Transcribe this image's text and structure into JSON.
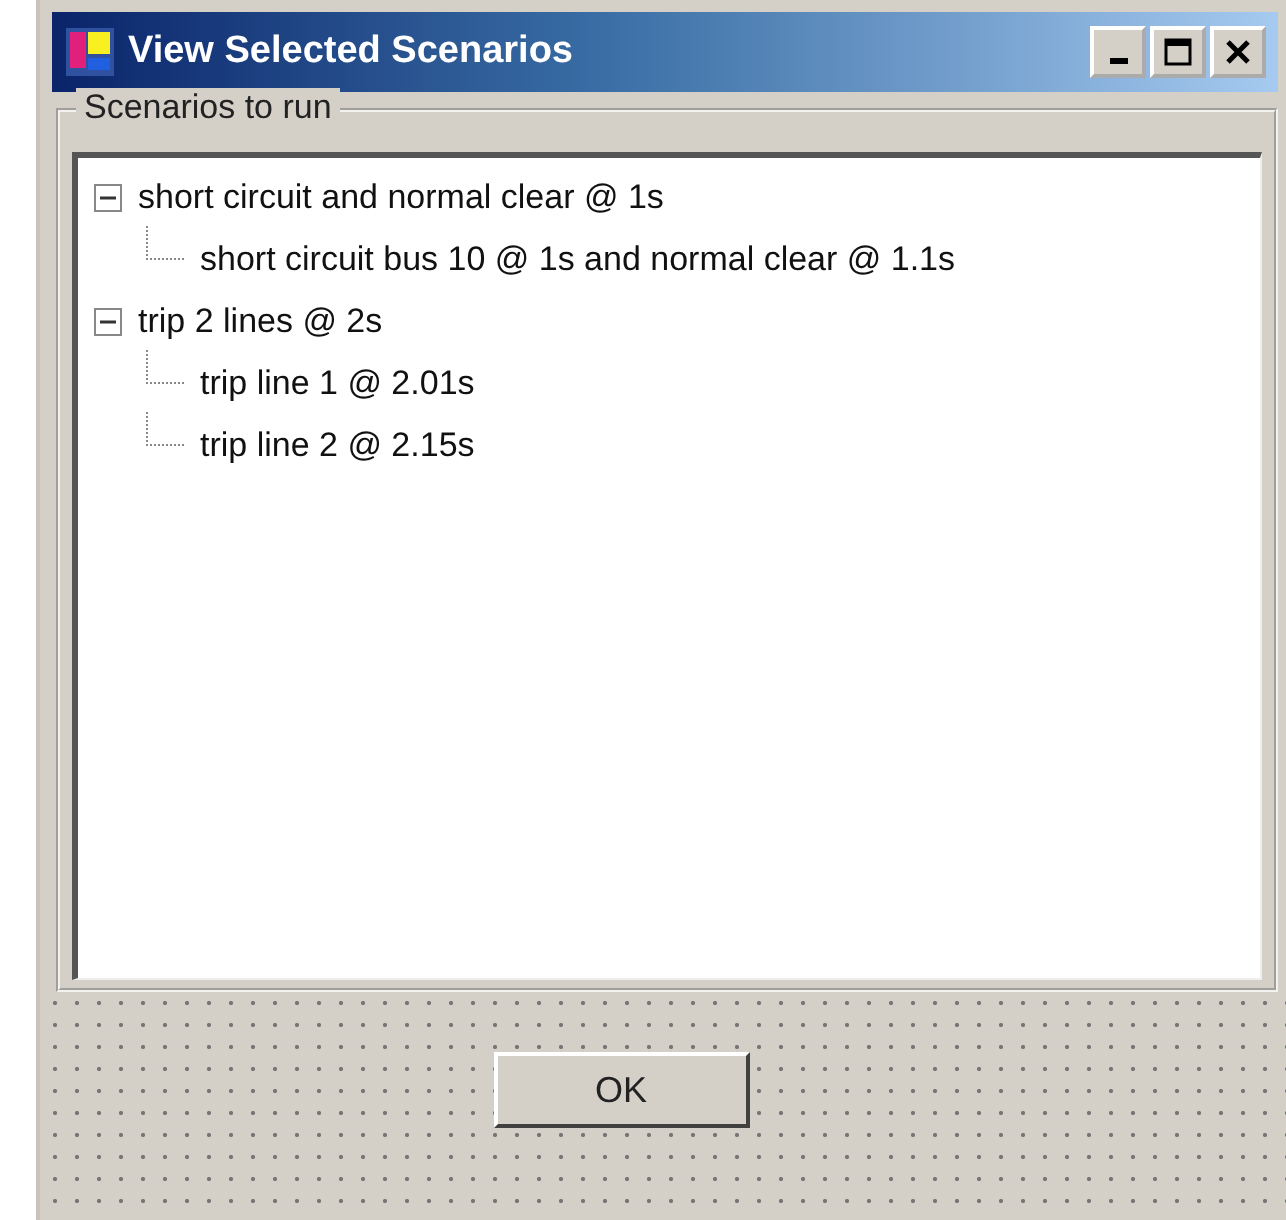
{
  "window": {
    "title": "View Selected Scenarios"
  },
  "group": {
    "label": "Scenarios to run"
  },
  "tree": [
    {
      "label": "short circuit and normal clear @ 1s",
      "expanded": true,
      "children": [
        {
          "label": "short circuit bus 10 @ 1s and normal clear @ 1.1s"
        }
      ]
    },
    {
      "label": "trip 2 lines @ 2s",
      "expanded": true,
      "children": [
        {
          "label": "trip line 1 @ 2.01s"
        },
        {
          "label": "trip line 2 @ 2.15s"
        }
      ]
    }
  ],
  "buttons": [
    {
      "label": "OK"
    }
  ]
}
